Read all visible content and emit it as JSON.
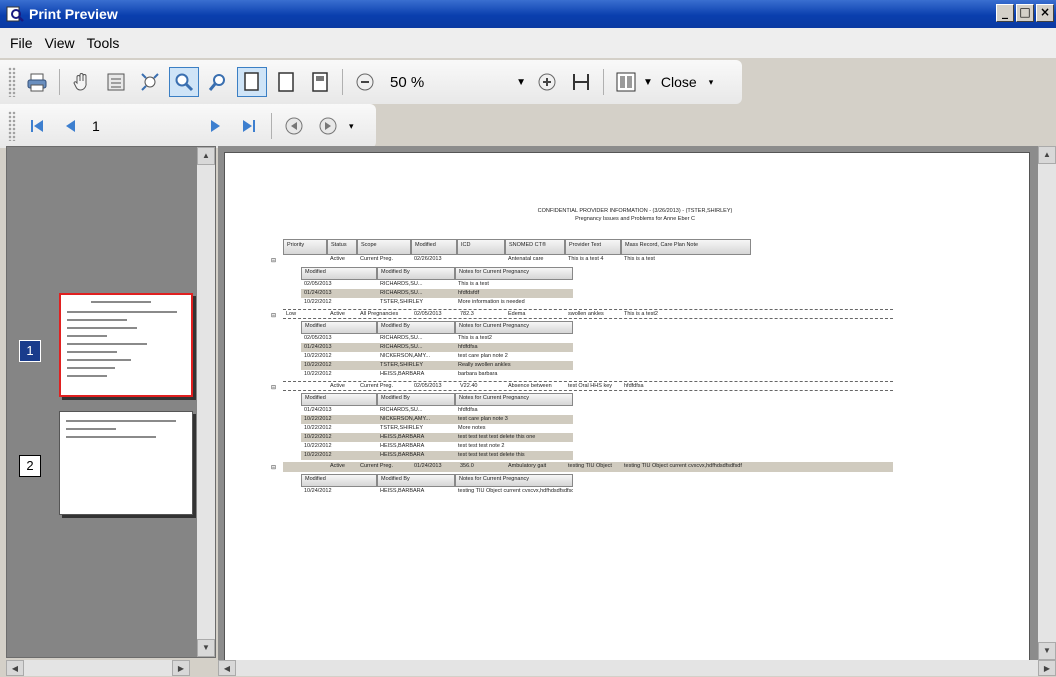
{
  "window": {
    "title": "Print Preview",
    "controls": [
      "_",
      "□",
      "×"
    ]
  },
  "menu": [
    "File",
    "View",
    "Tools"
  ],
  "toolbar": {
    "zoom_value": "50 %",
    "close_label": "Close",
    "page_number": "1"
  },
  "thumbnails": [
    {
      "number": "1",
      "selected": true
    },
    {
      "number": "2",
      "selected": false
    }
  ],
  "report": {
    "header_line1": "CONFIDENTIAL PROVIDER INFORMATION - (3/26/2013) - (TSTER,SHIRLEY)",
    "header_line2": "Pregnancy Issues and Problems for Anne Eber C",
    "columns": [
      "Priority",
      "Status",
      "Scope",
      "Modified",
      "ICD",
      "SNOMED CT®",
      "Provider Text",
      "Mass Record, Care Plan Note"
    ],
    "note_columns": [
      "Modified",
      "Modified By",
      "Notes for Current Pregnancy"
    ],
    "problems": [
      {
        "cells": [
          "",
          "Active",
          "Current Preg.",
          "02/26/2013",
          "",
          "Antenatal care",
          "This is a test 4",
          "This is a test"
        ],
        "style": "plain",
        "notes": [
          [
            "02/05/2013",
            "RICHARDS,SU...",
            "This is a test"
          ],
          [
            "01/24/2013",
            "RICHARDS,SU...",
            "hfdfdsfdf"
          ],
          [
            "10/22/2012",
            "TSTER,SHIRLEY",
            "More information is needed"
          ]
        ]
      },
      {
        "cells": [
          "Low",
          "Active",
          "All Pregnancies",
          "02/05/2013",
          "782.3",
          "Edema",
          "swollen ankles",
          "This is a test2"
        ],
        "style": "dashed",
        "notes": [
          [
            "02/05/2013",
            "RICHARDS,SU...",
            "This is a test2"
          ],
          [
            "01/24/2013",
            "RICHARDS,SU...",
            "hfdfdfsa"
          ],
          [
            "10/22/2012",
            "NICKERSON,AMY...",
            "test care plan note 2"
          ],
          [
            "10/22/2012",
            "TSTER,SHIRLEY",
            "Really swollen ankles"
          ],
          [
            "10/22/2012",
            "HEISS,BARBARA",
            "barbara barbara"
          ]
        ]
      },
      {
        "cells": [
          "",
          "Active",
          "Current Preg.",
          "02/05/2013",
          "V22.40",
          "Absence between",
          "test Oral HHS key",
          "hfdfdfsa"
        ],
        "style": "dashed",
        "notes": [
          [
            "01/24/2013",
            "RICHARDS,SU...",
            "hfdfdfsa"
          ],
          [
            "10/22/2012",
            "NICKERSON,AMY...",
            "test care plan note 3"
          ],
          [
            "10/22/2012",
            "TSTER,SHIRLEY",
            "More notes"
          ],
          [
            "10/22/2012",
            "HEISS,BARBARA",
            "test test test test delete this one"
          ],
          [
            "10/22/2012",
            "HEISS,BARBARA",
            "test test test note 2"
          ],
          [
            "10/22/2012",
            "HEISS,BARBARA",
            "test test test test delete this"
          ]
        ]
      },
      {
        "cells": [
          "",
          "Active",
          "Current Preg.",
          "01/24/2013",
          "356.0",
          "Ambulatory gait",
          "testing TIU Object",
          "testing TIU Object current cvxcvx,hdfhdsdfsdfsdf"
        ],
        "style": "shaded",
        "notes": [
          [
            "10/24/2012",
            "HEISS,BARBARA",
            "testing TIU Object current cvxcvx,hdfhdsdfsdfsdf"
          ]
        ]
      }
    ]
  }
}
